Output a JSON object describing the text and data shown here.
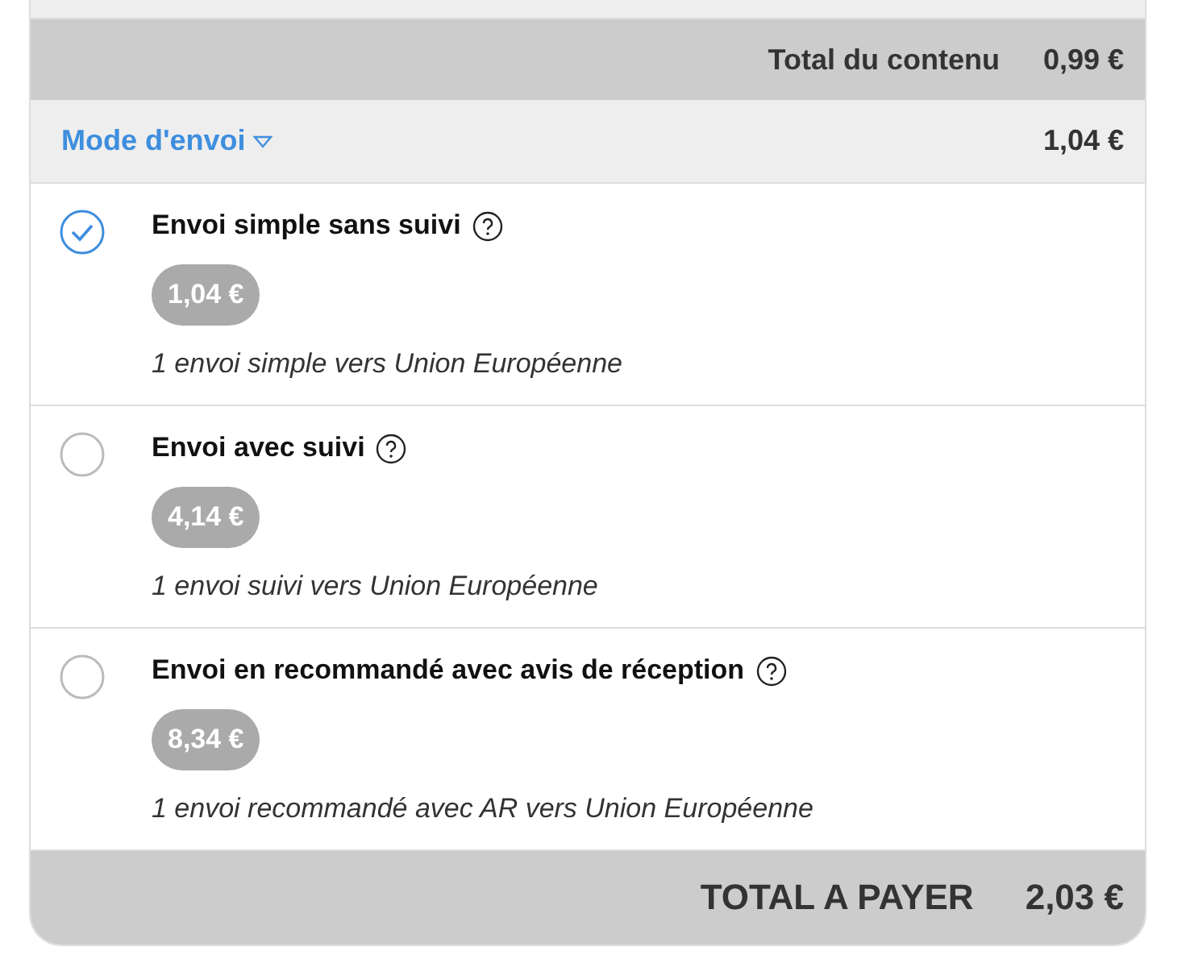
{
  "content_total": {
    "label": "Total du contenu",
    "amount": "0,99 €"
  },
  "shipping": {
    "label": "Mode d'envoi",
    "amount": "1,04 €",
    "expanded": true
  },
  "options": [
    {
      "name": "Envoi simple sans suivi",
      "price": "1,04 €",
      "description": "1 envoi simple vers Union Européenne",
      "selected": true
    },
    {
      "name": "Envoi avec suivi",
      "price": "4,14 €",
      "description": "1 envoi suivi vers Union Européenne",
      "selected": false
    },
    {
      "name": "Envoi en recommandé avec avis de réception",
      "price": "8,34 €",
      "description": "1 envoi recommandé avec AR vers Union Européenne",
      "selected": false
    }
  ],
  "grand_total": {
    "label": "TOTAL A PAYER",
    "amount": "2,03 €"
  }
}
